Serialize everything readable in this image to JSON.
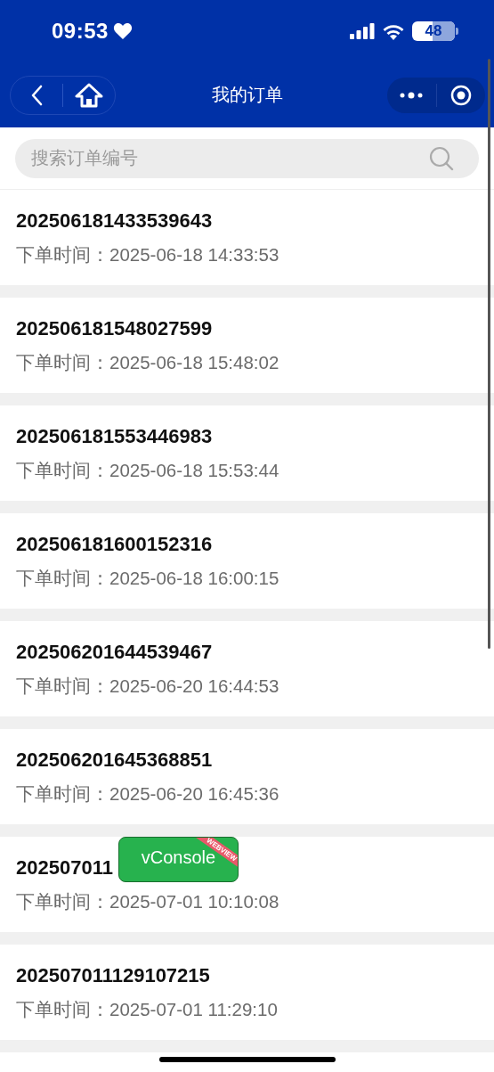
{
  "status_bar": {
    "time": "09:53",
    "battery": "48"
  },
  "nav": {
    "title": "我的订单"
  },
  "search": {
    "placeholder": "搜索订单编号"
  },
  "orders": [
    {
      "number": "202506181433539643",
      "time": "下单时间：2025-06-18 14:33:53"
    },
    {
      "number": "202506181548027599",
      "time": "下单时间：2025-06-18 15:48:02"
    },
    {
      "number": "202506181553446983",
      "time": "下单时间：2025-06-18 15:53:44"
    },
    {
      "number": "202506181600152316",
      "time": "下单时间：2025-06-18 16:00:15"
    },
    {
      "number": "202506201644539467",
      "time": "下单时间：2025-06-20 16:44:53"
    },
    {
      "number": "202506201645368851",
      "time": "下单时间：2025-06-20 16:45:36"
    },
    {
      "number": "202507011",
      "time": "下单时间：2025-07-01 10:10:08"
    },
    {
      "number": "202507011129107215",
      "time": "下单时间：2025-07-01 11:29:10"
    }
  ],
  "vconsole": {
    "label": "vConsole",
    "ribbon": "WEBVIEW"
  }
}
